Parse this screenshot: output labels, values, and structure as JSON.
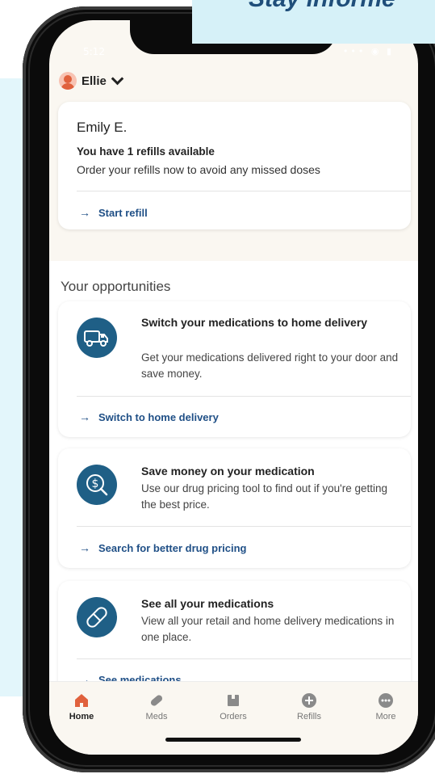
{
  "banner": {
    "text": "Stay informe"
  },
  "status_bar": {
    "time": "5:12",
    "icons": "••• ◉ ▮"
  },
  "profile": {
    "name": "Ellie"
  },
  "refill_card": {
    "member_name": "Emily E.",
    "headline": "You have 1 refills available",
    "subtext": "Order your refills now to avoid any missed doses",
    "action_label": "Start refill"
  },
  "opportunities": {
    "section_title": "Your opportunities",
    "items": [
      {
        "icon": "delivery-truck-icon",
        "title": "Switch your medications to home delivery",
        "description": "Get your medications delivered right to your door and save money.",
        "action_label": "Switch to home delivery"
      },
      {
        "icon": "dollar-search-icon",
        "title": "Save money on your medication",
        "description": "Use our drug pricing tool to find out if you're getting the best price.",
        "action_label": "Search for better drug pricing"
      },
      {
        "icon": "pill-icon",
        "title": "See all your medications",
        "description": "View all your retail and home delivery medications in one place.",
        "action_label": "See medications"
      }
    ]
  },
  "tabs": [
    {
      "label": "Home",
      "icon": "home-icon",
      "active": true
    },
    {
      "label": "Meds",
      "icon": "pill-icon",
      "active": false
    },
    {
      "label": "Orders",
      "icon": "box-icon",
      "active": false
    },
    {
      "label": "Refills",
      "icon": "plus-circle-icon",
      "active": false
    },
    {
      "label": "More",
      "icon": "more-dots-icon",
      "active": false
    }
  ],
  "colors": {
    "accent_blue": "#1f4f86",
    "icon_circle": "#1f5f86",
    "home_active": "#e0613d",
    "tab_inactive": "#8a8a8a",
    "background_panel": "#e3f6fb"
  }
}
